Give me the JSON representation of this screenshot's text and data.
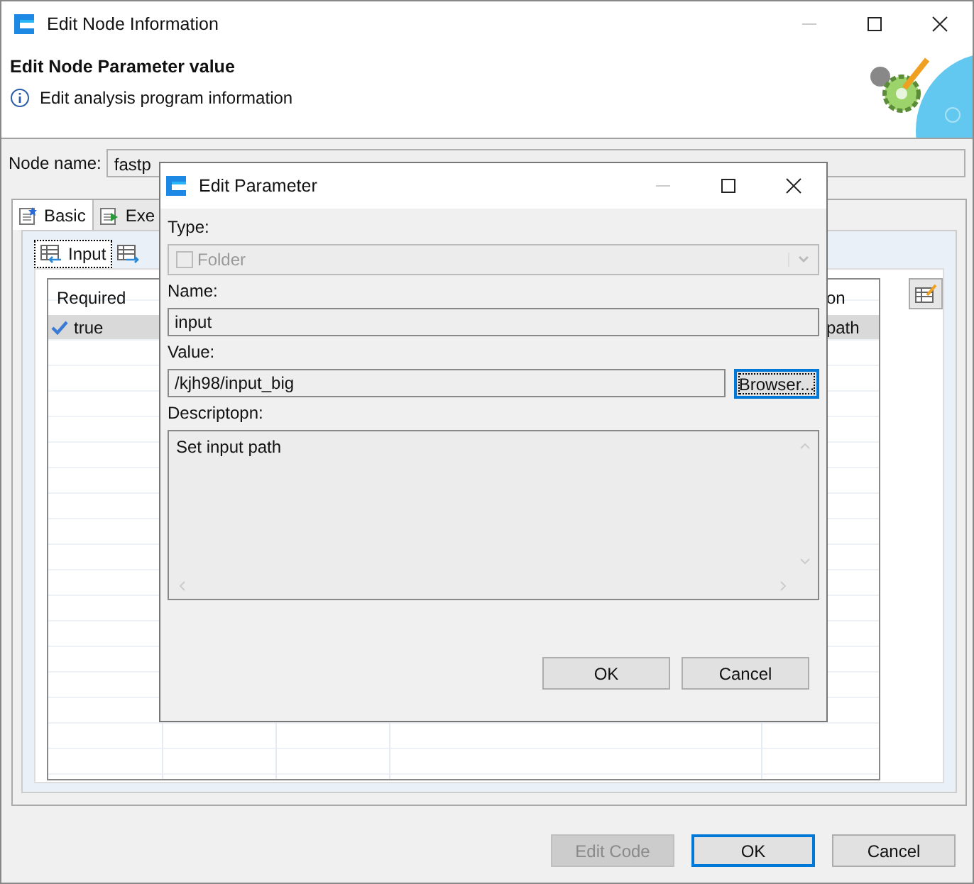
{
  "window": {
    "title": "Edit Node Information"
  },
  "header": {
    "title": "Edit Node Parameter value",
    "message": "Edit analysis program information"
  },
  "node_name": {
    "label": "Node name:",
    "value": "fastp"
  },
  "tabs": [
    {
      "label": "Basic",
      "selected": true
    },
    {
      "label": "Exe",
      "selected": false
    }
  ],
  "sub_tabs": [
    {
      "label": "Input",
      "selected": true
    },
    {
      "selected": false
    }
  ],
  "table": {
    "columns": [
      "Required",
      "on"
    ],
    "rows": [
      {
        "required": "true",
        "checked": true,
        "column_5": "path",
        "selected": true
      }
    ]
  },
  "buttons": [
    {
      "label": "Edit Code",
      "disabled": true,
      "default": false
    },
    {
      "label": "OK",
      "disabled": false,
      "default": true
    },
    {
      "label": "Cancel",
      "disabled": false,
      "default": false
    }
  ],
  "dialog": {
    "title": "Edit Parameter",
    "type_label": "Type:",
    "folder": {
      "label": "Folder",
      "checked": false,
      "disabled": true
    },
    "name_label": "Name:",
    "name": "input",
    "value_label": "Value:",
    "value": "/kjh98/input_big",
    "browse_button": {
      "label": "Browser...",
      "focused": true
    },
    "description_label": "Descriptopn:",
    "description": "Set input path",
    "buttons": [
      {
        "label": "OK"
      },
      {
        "label": "Cancel"
      }
    ]
  }
}
